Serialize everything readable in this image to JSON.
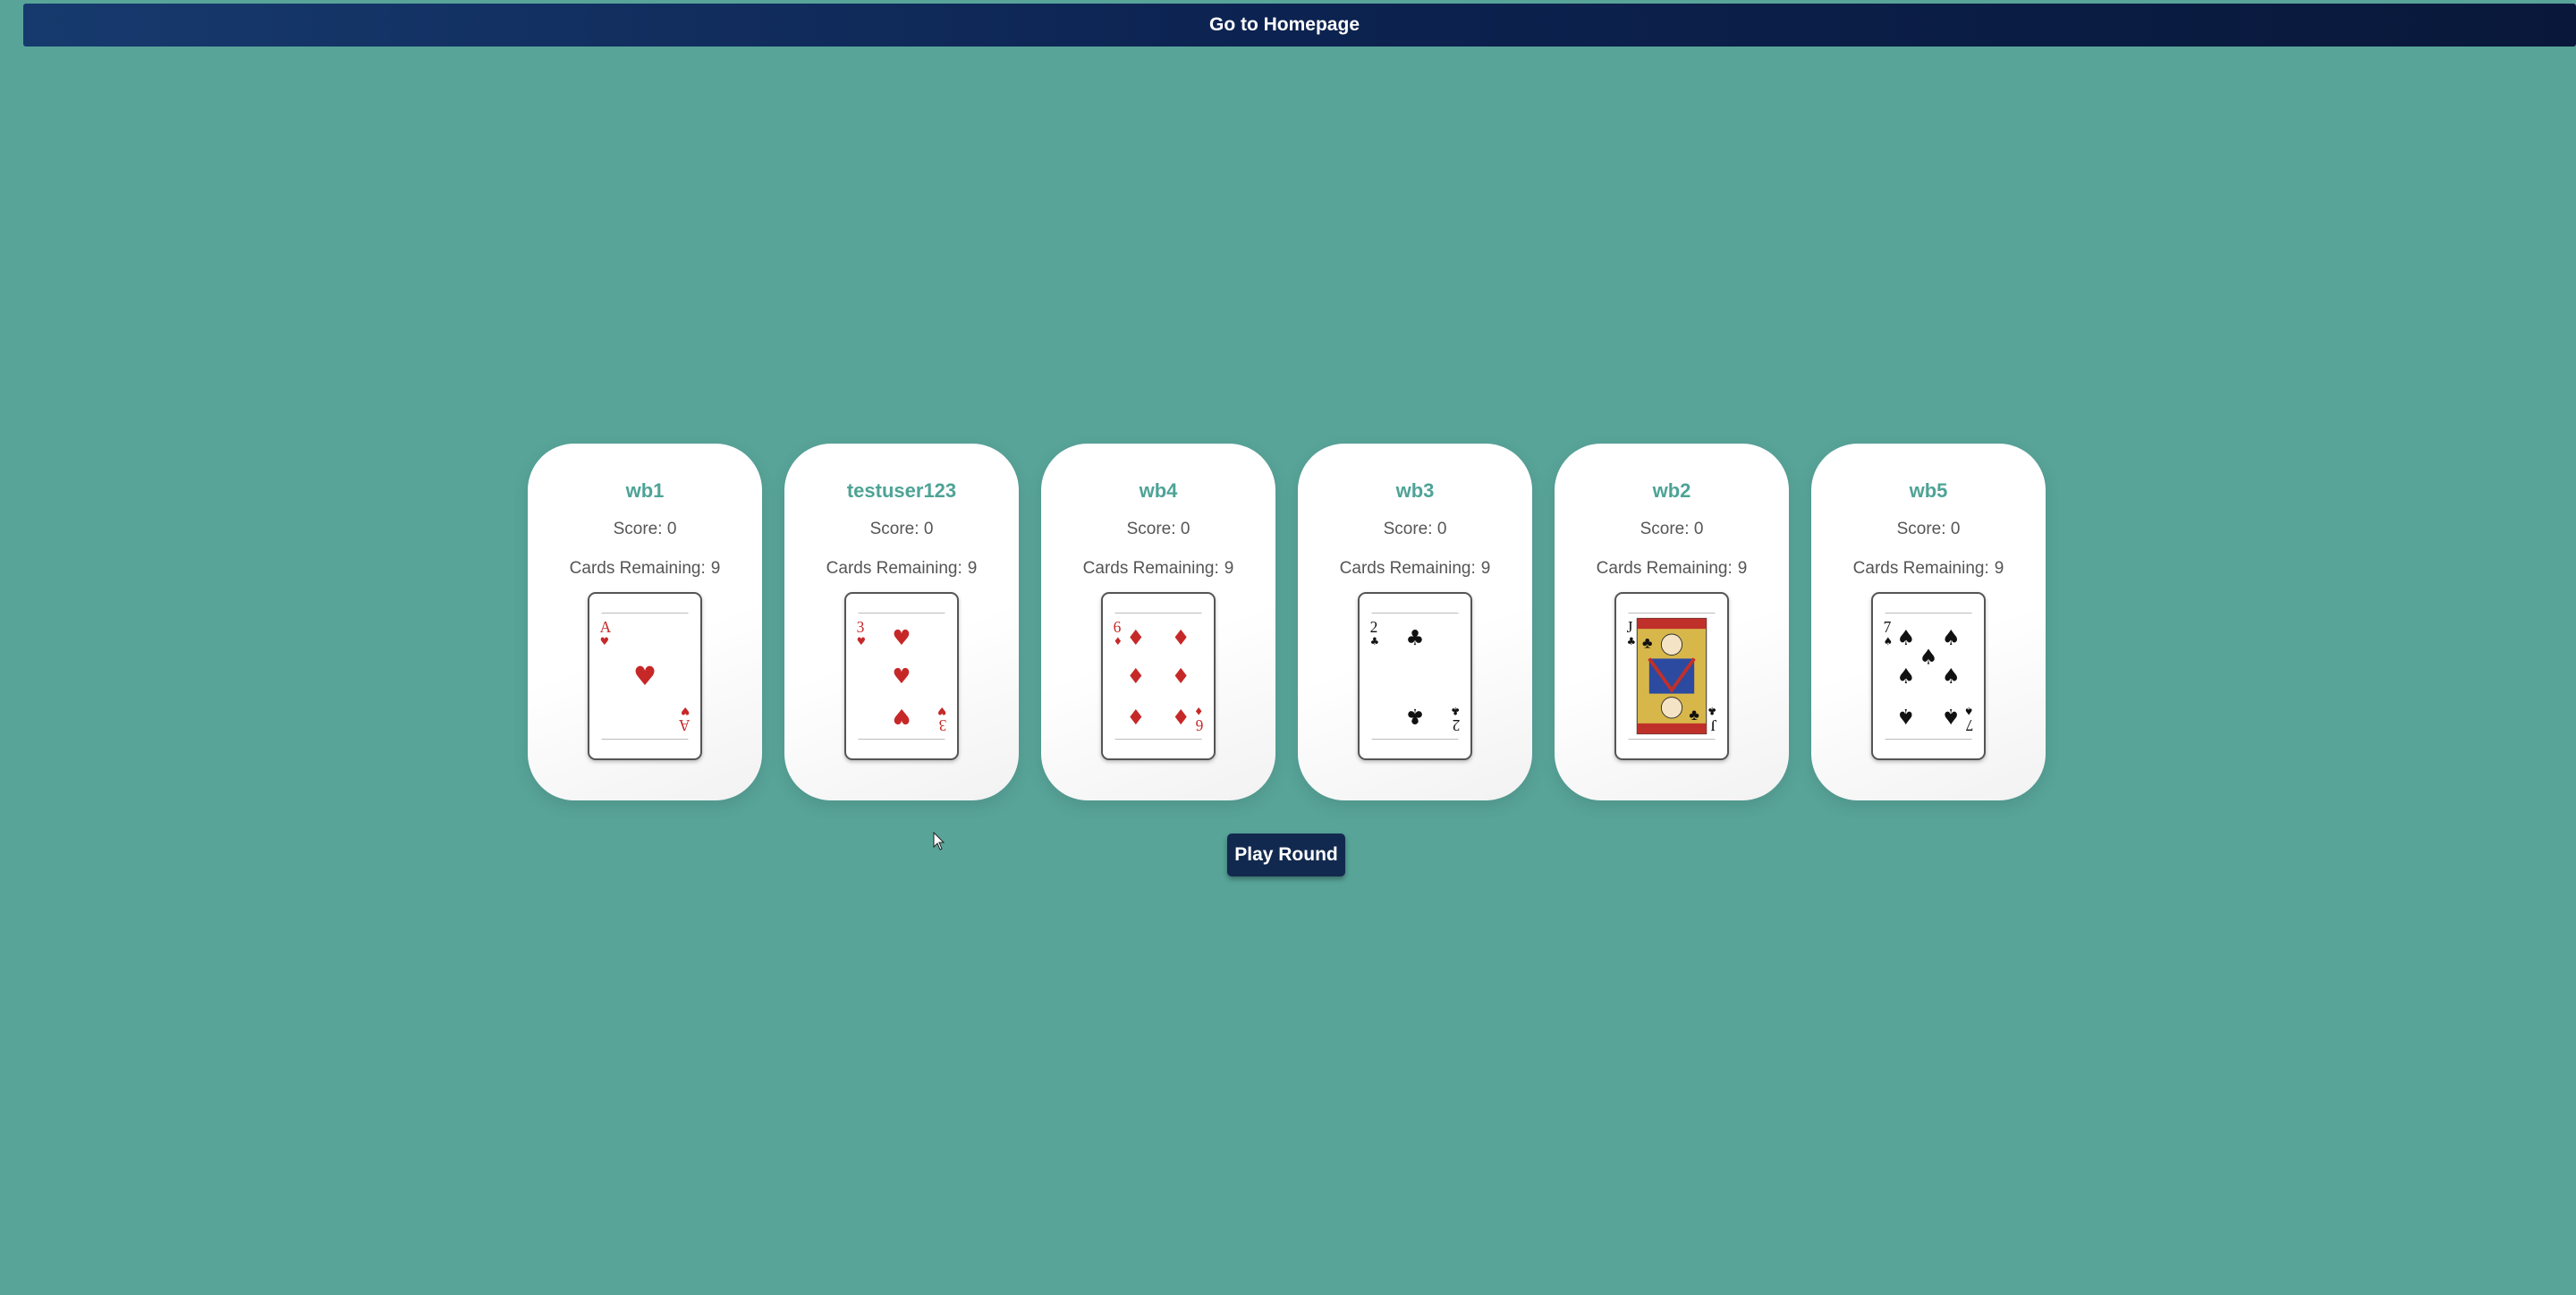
{
  "header": {
    "home_label": "Go to Homepage"
  },
  "labels": {
    "score_prefix": "Score:",
    "cards_prefix": "Cards Remaining:"
  },
  "players": [
    {
      "name": "wb1",
      "score": "0",
      "cards_remaining": "9",
      "card": {
        "rank": "A",
        "suit": "hearts",
        "color": "#c62828"
      }
    },
    {
      "name": "testuser123",
      "score": "0",
      "cards_remaining": "9",
      "card": {
        "rank": "3",
        "suit": "hearts",
        "color": "#c62828"
      }
    },
    {
      "name": "wb4",
      "score": "0",
      "cards_remaining": "9",
      "card": {
        "rank": "6",
        "suit": "diamonds",
        "color": "#c62828"
      }
    },
    {
      "name": "wb3",
      "score": "0",
      "cards_remaining": "9",
      "card": {
        "rank": "2",
        "suit": "clubs",
        "color": "#111111"
      }
    },
    {
      "name": "wb2",
      "score": "0",
      "cards_remaining": "9",
      "card": {
        "rank": "J",
        "suit": "clubs",
        "color": "#111111"
      }
    },
    {
      "name": "wb5",
      "score": "0",
      "cards_remaining": "9",
      "card": {
        "rank": "7",
        "suit": "spades",
        "color": "#111111"
      }
    }
  ],
  "actions": {
    "play_round_label": "Play Round"
  },
  "colors": {
    "background": "#58a499",
    "accent": "#4ea396",
    "button": "#12294f"
  }
}
